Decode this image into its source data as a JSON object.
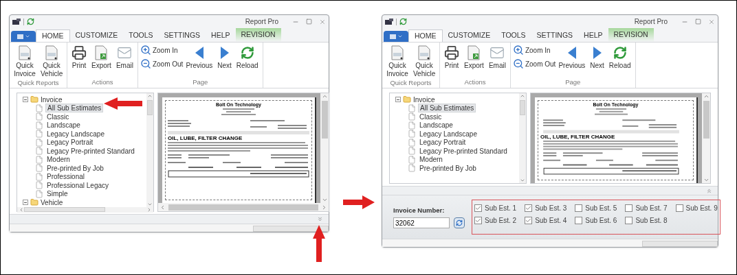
{
  "windows": [
    {
      "title": "Report Pro",
      "tabs": [
        {
          "label": "HOME",
          "selected": true,
          "kind": "normal"
        },
        {
          "label": "CUSTOMIZE",
          "selected": false,
          "kind": "normal"
        },
        {
          "label": "TOOLS",
          "selected": false,
          "kind": "normal"
        },
        {
          "label": "SETTINGS",
          "selected": false,
          "kind": "normal"
        },
        {
          "label": "HELP",
          "selected": false,
          "kind": "normal"
        },
        {
          "label": "REVISION",
          "selected": false,
          "kind": "contextual"
        }
      ],
      "groups": [
        {
          "label": "Quick Reports",
          "buttons": [
            {
              "label": "Quick Invoice",
              "kind": "large"
            },
            {
              "label": "Quick Vehicle",
              "kind": "large"
            }
          ]
        },
        {
          "label": "Actions",
          "buttons": [
            {
              "label": "Print",
              "kind": "large"
            },
            {
              "label": "Export",
              "kind": "large"
            },
            {
              "label": "Email",
              "kind": "large"
            }
          ]
        },
        {
          "label": "Page",
          "buttons": [
            {
              "label": "Zoom In",
              "kind": "small"
            },
            {
              "label": "Zoom Out",
              "kind": "small"
            },
            {
              "label": "Previous",
              "kind": "large"
            },
            {
              "label": "Next",
              "kind": "large"
            },
            {
              "label": "Reload",
              "kind": "large"
            }
          ]
        }
      ],
      "tree": [
        {
          "label": "Invoice",
          "expanded": true,
          "children": [
            {
              "label": "All Sub Estimates",
              "selected": true
            },
            {
              "label": "Classic",
              "selected": false
            },
            {
              "label": "Landscape",
              "selected": false
            },
            {
              "label": "Legacy Landscape",
              "selected": false
            },
            {
              "label": "Legacy Portrait",
              "selected": false
            },
            {
              "label": "Legacy Pre-printed Standard",
              "selected": false
            },
            {
              "label": "Modern",
              "selected": false
            },
            {
              "label": "Pre-printed By Job",
              "selected": false
            },
            {
              "label": "Professional",
              "selected": false
            },
            {
              "label": "Professional Legacy",
              "selected": false
            },
            {
              "label": "Simple",
              "selected": false
            }
          ]
        },
        {
          "label": "Vehicle",
          "expanded": true
        }
      ],
      "preview": {
        "title": "Bolt On Technology",
        "heading": "OIL, LUBE, FILTER CHANGE"
      },
      "options_expanded": false
    },
    {
      "title": "Report Pro",
      "tabs": [
        {
          "label": "HOME",
          "selected": true,
          "kind": "normal"
        },
        {
          "label": "CUSTOMIZE",
          "selected": false,
          "kind": "normal"
        },
        {
          "label": "TOOLS",
          "selected": false,
          "kind": "normal"
        },
        {
          "label": "SETTINGS",
          "selected": false,
          "kind": "normal"
        },
        {
          "label": "HELP",
          "selected": false,
          "kind": "normal"
        },
        {
          "label": "REVISION",
          "selected": false,
          "kind": "contextual"
        }
      ],
      "groups": [
        {
          "label": "Quick Reports",
          "buttons": [
            {
              "label": "Quick Invoice",
              "kind": "large"
            },
            {
              "label": "Quick Vehicle",
              "kind": "large"
            }
          ]
        },
        {
          "label": "Actions",
          "buttons": [
            {
              "label": "Print",
              "kind": "large"
            },
            {
              "label": "Export",
              "kind": "large"
            },
            {
              "label": "Email",
              "kind": "large"
            }
          ]
        },
        {
          "label": "Page",
          "buttons": [
            {
              "label": "Zoom In",
              "kind": "small"
            },
            {
              "label": "Zoom Out",
              "kind": "small"
            },
            {
              "label": "Previous",
              "kind": "large"
            },
            {
              "label": "Next",
              "kind": "large"
            },
            {
              "label": "Reload",
              "kind": "large"
            }
          ]
        }
      ],
      "tree": [
        {
          "label": "Invoice",
          "expanded": true,
          "children": [
            {
              "label": "All Sub Estimates",
              "selected": true
            },
            {
              "label": "Classic",
              "selected": false
            },
            {
              "label": "Landscape",
              "selected": false
            },
            {
              "label": "Legacy Landscape",
              "selected": false
            },
            {
              "label": "Legacy Portrait",
              "selected": false
            },
            {
              "label": "Legacy Pre-printed Standard",
              "selected": false
            },
            {
              "label": "Modern",
              "selected": false
            },
            {
              "label": "Pre-printed By Job",
              "selected": false
            }
          ]
        }
      ],
      "preview": {
        "title": "Bolt On Technology",
        "heading": "OIL, LUBE, FILTER CHANGE"
      },
      "options_expanded": true,
      "options": {
        "invoice_label": "Invoice Number:",
        "invoice_number": "32062",
        "sub_estimates": [
          {
            "label": "Sub Est. 1",
            "checked": true
          },
          {
            "label": "Sub Est. 2",
            "checked": true
          },
          {
            "label": "Sub Est. 3",
            "checked": true
          },
          {
            "label": "Sub Est. 4",
            "checked": true
          },
          {
            "label": "Sub Est. 5",
            "checked": false
          },
          {
            "label": "Sub Est. 6",
            "checked": false
          },
          {
            "label": "Sub Est. 7",
            "checked": false
          },
          {
            "label": "Sub Est. 8",
            "checked": false
          },
          {
            "label": "Sub Est. 9",
            "checked": false
          }
        ]
      }
    }
  ]
}
